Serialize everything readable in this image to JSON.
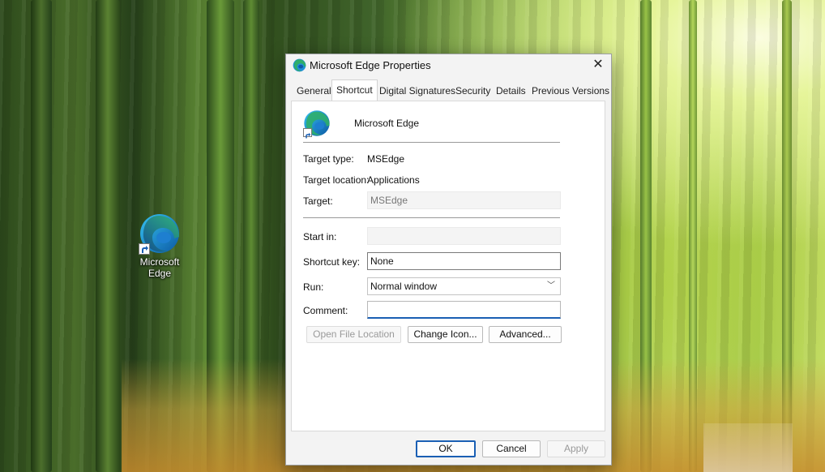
{
  "desktop": {
    "icon_label_line1": "Microsoft",
    "icon_label_line2": "Edge"
  },
  "dialog": {
    "title": "Microsoft Edge Properties",
    "close_glyph": "✕",
    "tabs": [
      "General",
      "Shortcut",
      "Digital Signatures",
      "Security",
      "Details",
      "Previous Versions"
    ],
    "active_tab": "Shortcut",
    "app_name": "Microsoft Edge",
    "fields": {
      "target_type_label": "Target type:",
      "target_type_value": "MSEdge",
      "target_location_label": "Target location:",
      "target_location_value": "Applications",
      "target_label": "Target:",
      "target_value": "MSEdge",
      "start_in_label": "Start in:",
      "start_in_value": "",
      "shortcut_key_label": "Shortcut key:",
      "shortcut_key_value": "None",
      "run_label": "Run:",
      "run_value": "Normal window",
      "comment_label": "Comment:",
      "comment_value": ""
    },
    "buttons": {
      "open_file_location": "Open File Location",
      "change_icon": "Change Icon...",
      "advanced": "Advanced...",
      "ok": "OK",
      "cancel": "Cancel",
      "apply": "Apply"
    }
  },
  "icons": {
    "app": "microsoft-edge-icon",
    "shortcut_overlay": "shortcut-arrow-icon",
    "dropdown": "chevron-down-icon",
    "close": "close-icon"
  },
  "colors": {
    "accent": "#1a5fb4",
    "dialog_bg": "#f3f3f3",
    "panel_bg": "#ffffff"
  }
}
